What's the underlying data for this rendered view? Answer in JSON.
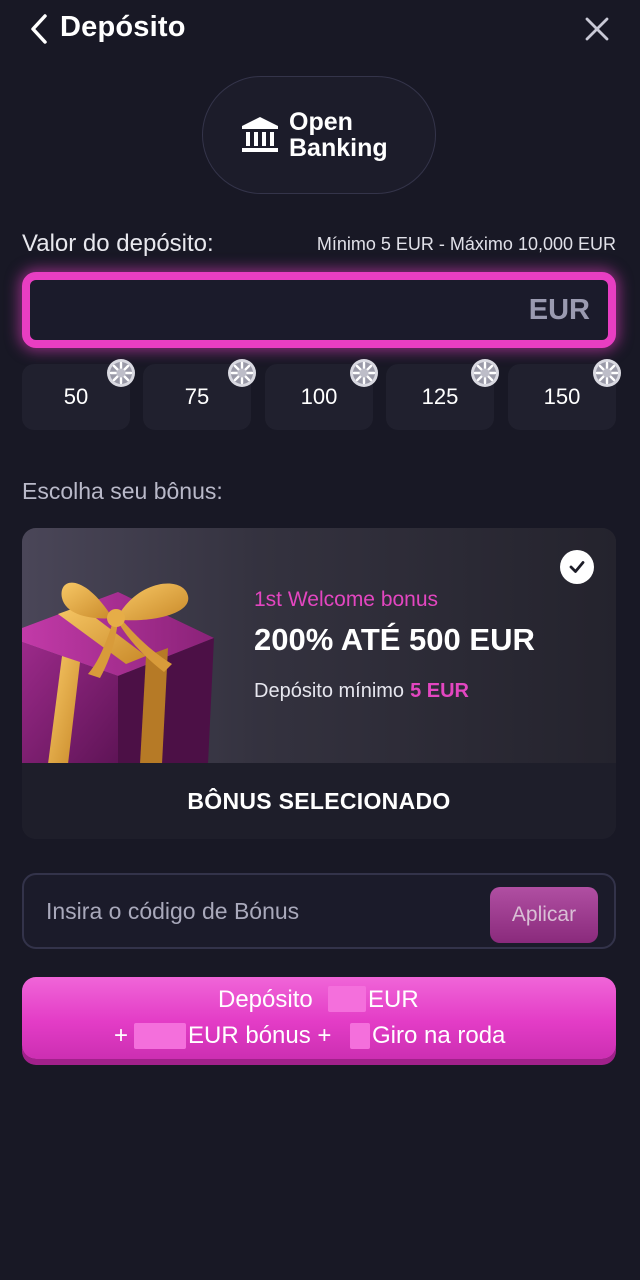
{
  "header": {
    "title": "Depósito"
  },
  "payment_method": {
    "label": "Open Banking"
  },
  "amount": {
    "label": "Valor do depósito:",
    "limits": "Mínimo 5 EUR - Máximo 10,000 EUR",
    "value": "",
    "currency": "EUR"
  },
  "quick_amounts": [
    "50",
    "75",
    "100",
    "125",
    "150"
  ],
  "bonus": {
    "heading": "Escolha seu bônus:",
    "subtitle": "1st Welcome bonus",
    "title": "200% ATÉ 500 EUR",
    "min_label": "Depósito mínimo",
    "min_value": "5 EUR",
    "status": "BÔNUS SELECIONADO",
    "selected": true
  },
  "promo": {
    "placeholder": "Insira o código de Bónus",
    "apply_label": "Aplicar"
  },
  "cta": {
    "deposit_word": "Depósito",
    "currency": "EUR",
    "plus": "+",
    "bonus_text": "EUR bónus +",
    "wheel_text": "Giro na roda"
  },
  "colors": {
    "background": "#181825",
    "accent": "#e83ec2",
    "accent_text": "#e346c0"
  }
}
